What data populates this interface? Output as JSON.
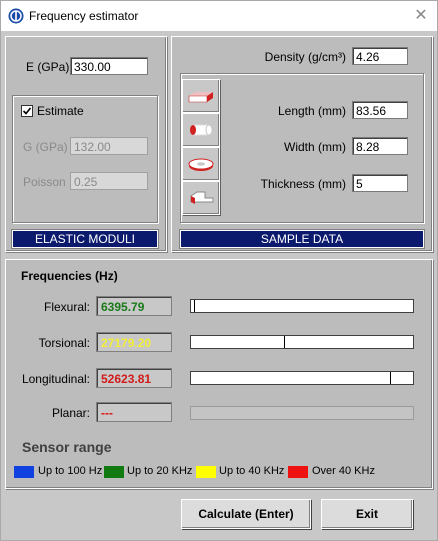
{
  "window": {
    "title": "Frequency estimator"
  },
  "elastic": {
    "e_label": "E (GPa)",
    "e_value": "330.00",
    "estimate_label": "Estimate",
    "estimate_checked": true,
    "g_label": "G (GPa)",
    "g_value": "132.00",
    "poisson_label": "Poisson",
    "poisson_value": "0.25",
    "section_label": "ELASTIC MODULI"
  },
  "sample": {
    "density_label": "Density (g/cm³)",
    "density_value": "4.26",
    "length_label": "Length (mm)",
    "length_value": "83.56",
    "width_label": "Width (mm)",
    "width_value": "8.28",
    "thickness_label": "Thickness (mm)",
    "thickness_value": "5",
    "section_label": "SAMPLE DATA",
    "shapes": [
      "bar-shape-icon",
      "cylinder-shape-icon",
      "disc-shape-icon",
      "custom-shape-icon"
    ]
  },
  "frequencies": {
    "title": "Frequencies (Hz)",
    "rows": [
      {
        "label": "Flexural:",
        "value": "6395.79",
        "color": "#1a7a1a",
        "level": 0.015
      },
      {
        "label": "Torsional:",
        "value": "27179.20",
        "color": "#f2ee3a",
        "level": 0.42
      },
      {
        "label": "Longitudinal:",
        "value": "52623.81",
        "color": "#d11a1a",
        "level": 0.895
      },
      {
        "label": "Planar:",
        "value": "---",
        "color": "#e01010",
        "level": null
      }
    ]
  },
  "sensor_range": {
    "title": "Sensor range",
    "items": [
      {
        "label": "Up to 100 Hz",
        "color": "#1040e0"
      },
      {
        "label": "Up to 20 KHz",
        "color": "#117a11"
      },
      {
        "label": "Up to 40 KHz",
        "color": "#ffff00"
      },
      {
        "label": "Over 40 KHz",
        "color": "#ee1111"
      }
    ]
  },
  "buttons": {
    "calculate": "Calculate (Enter)",
    "exit": "Exit"
  }
}
